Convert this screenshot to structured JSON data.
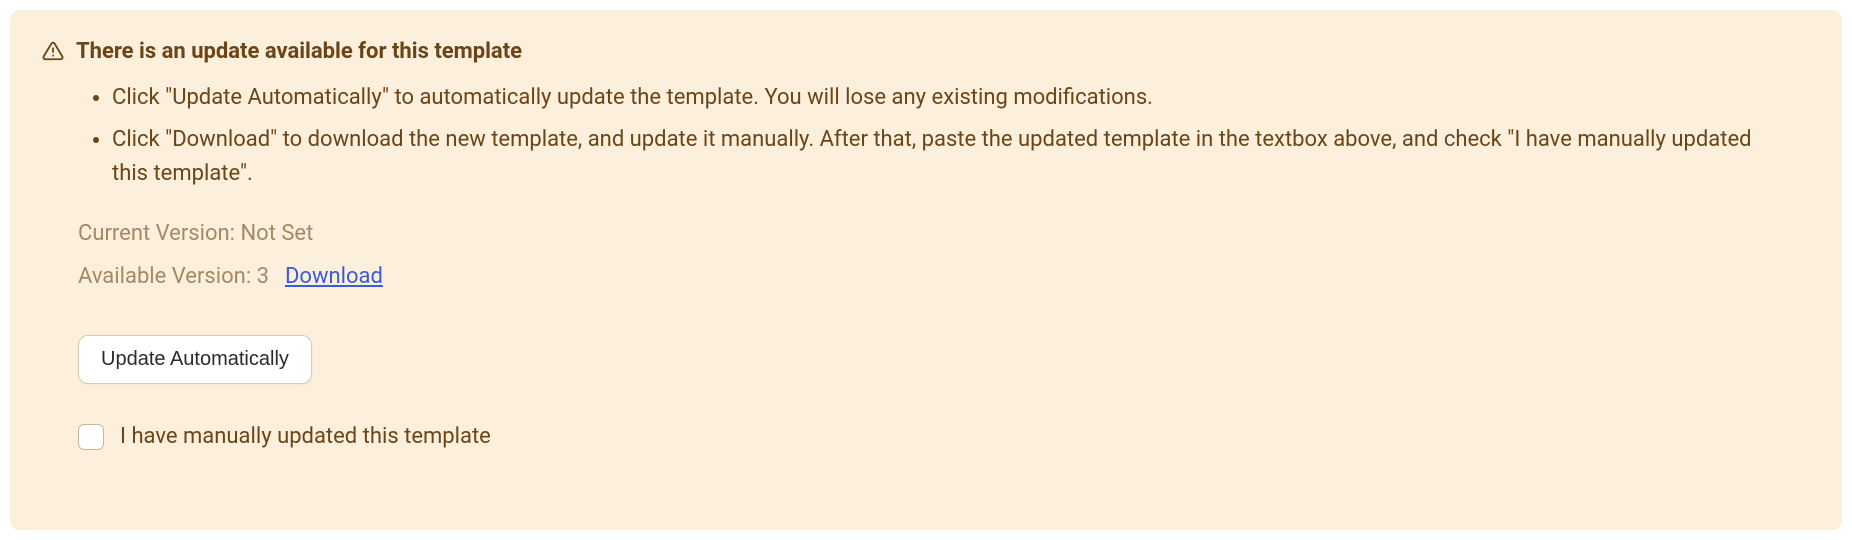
{
  "alert": {
    "title": "There is an update available for this template",
    "bullets": [
      "Click \"Update Automatically\" to automatically update the template. You will lose any existing modifications.",
      "Click \"Download\" to download the new template, and update it manually. After that, paste the updated template in the textbox above, and check \"I have manually updated this template\"."
    ],
    "current_version_label": "Current Version: Not Set",
    "available_version_label": "Available Version: 3",
    "download_link_label": "Download",
    "update_button_label": "Update Automatically",
    "checkbox_label": "I have manually updated this template"
  },
  "colors": {
    "background": "#fcefdc",
    "text_primary": "#6b4518",
    "text_muted": "#a38965",
    "link": "#3b5bdb"
  }
}
